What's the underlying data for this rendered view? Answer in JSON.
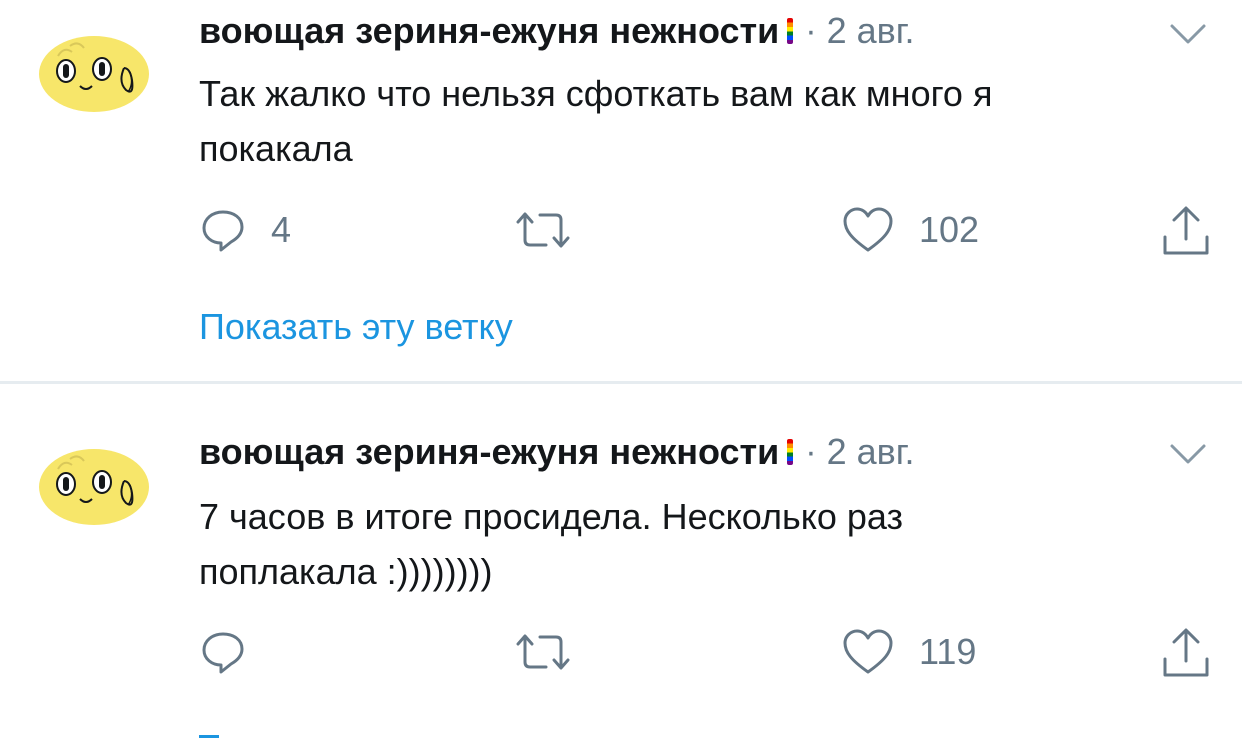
{
  "tweets": [
    {
      "author": {
        "display_name": "воющая зериня-ежуня нежности",
        "avatar_icon": "yellow-face-avatar"
      },
      "dot": "·",
      "date": "2 авг.",
      "text_lines": [
        "Так жалко что нельзя сфоткать вам как много я",
        "покакала"
      ],
      "actions": {
        "replies": "4",
        "retweets": "",
        "likes": "102"
      },
      "show_thread": "Показать эту ветку"
    },
    {
      "author": {
        "display_name": "воющая зериня-ежуня нежности",
        "avatar_icon": "yellow-face-avatar"
      },
      "dot": "·",
      "date": "2 авг.",
      "text_lines": [
        "7 часов в итоге просидела. Несколько раз",
        "поплакала :))))))))"
      ],
      "actions": {
        "replies": "",
        "retweets": "",
        "likes": "119"
      }
    }
  ],
  "icons": [
    "chevron-down-icon",
    "reply-icon",
    "retweet-icon",
    "like-icon",
    "share-icon",
    "rainbow-flag-emoji"
  ],
  "colors": {
    "text_primary": "#14171a",
    "text_secondary": "#657786",
    "link": "#1b95e0",
    "icon": "#657786",
    "avatar_yellow": "#f7e66a",
    "divider": "#e6ecf0"
  }
}
